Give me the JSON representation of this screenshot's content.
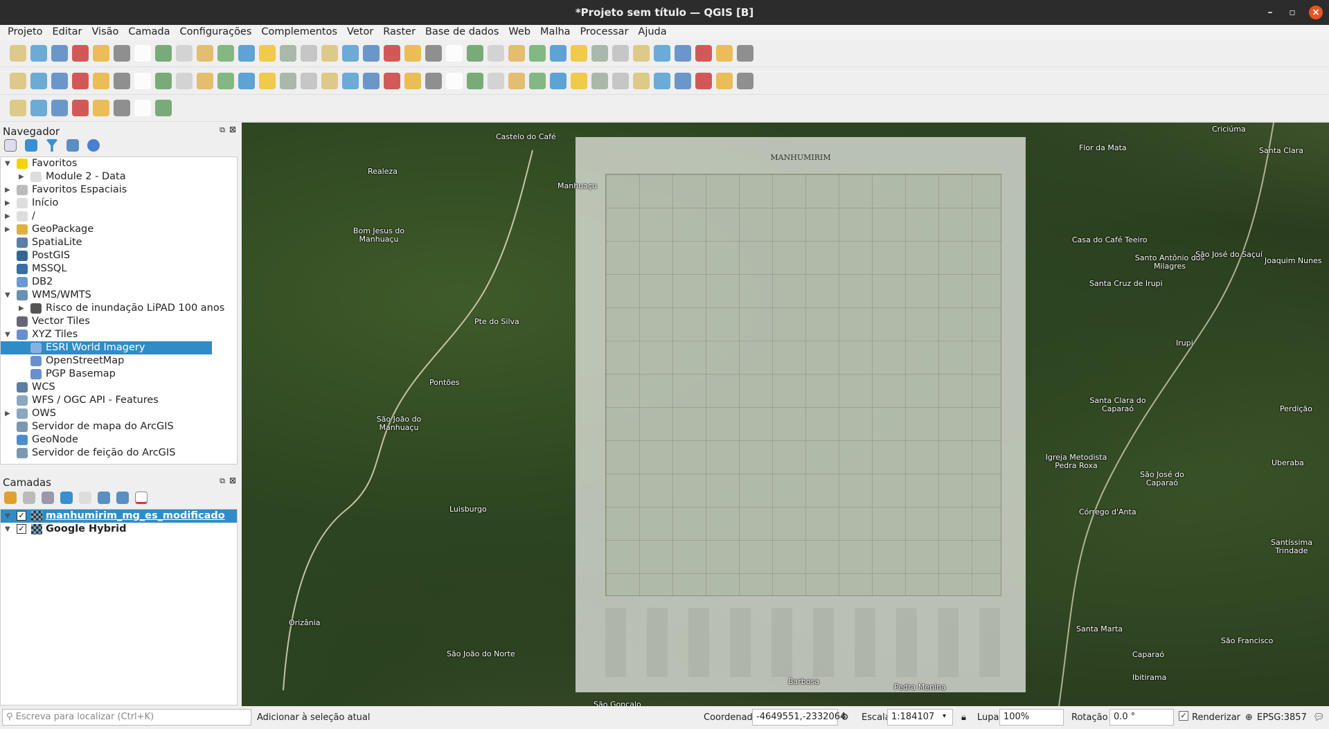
{
  "window": {
    "title": "*Projeto sem título — QGIS [B]"
  },
  "menu": [
    "Projeto",
    "Editar",
    "Visão",
    "Camada",
    "Configurações",
    "Complementos",
    "Vetor",
    "Raster",
    "Base de dados",
    "Web",
    "Malha",
    "Processar",
    "Ajuda"
  ],
  "browser": {
    "title": "Navegador",
    "items": [
      {
        "label": "Favoritos",
        "level": 0,
        "arrow": "down",
        "icon": "star-icon",
        "color": "#f5d300"
      },
      {
        "label": "Module 2 - Data",
        "level": 1,
        "arrow": "right",
        "icon": "folder-icon",
        "color": "#ddd"
      },
      {
        "label": "Favoritos Espaciais",
        "level": 0,
        "arrow": "right",
        "icon": "bookmark-icon",
        "color": "#bbb"
      },
      {
        "label": "Início",
        "level": 0,
        "arrow": "right",
        "icon": "home-icon",
        "color": "#ddd"
      },
      {
        "label": "/",
        "level": 0,
        "arrow": "right",
        "icon": "folder-icon",
        "color": "#ddd"
      },
      {
        "label": "GeoPackage",
        "level": 0,
        "arrow": "right",
        "icon": "geopackage-icon",
        "color": "#e0b040"
      },
      {
        "label": "SpatiaLite",
        "level": 0,
        "arrow": "",
        "icon": "feather-icon",
        "color": "#5a7fa8"
      },
      {
        "label": "PostGIS",
        "level": 0,
        "arrow": "",
        "icon": "elephant-icon",
        "color": "#336791"
      },
      {
        "label": "MSSQL",
        "level": 0,
        "arrow": "",
        "icon": "mssql-icon",
        "color": "#3a6ea5"
      },
      {
        "label": "DB2",
        "level": 0,
        "arrow": "",
        "icon": "db2-icon",
        "color": "#6a9ad0"
      },
      {
        "label": "WMS/WMTS",
        "level": 0,
        "arrow": "down",
        "icon": "globe-icon",
        "color": "#6a8fb0"
      },
      {
        "label": "Risco de inundação LiPAD 100 anos",
        "level": 1,
        "arrow": "right",
        "icon": "layer-icon",
        "color": "#555"
      },
      {
        "label": "Vector Tiles",
        "level": 0,
        "arrow": "",
        "icon": "grid-icon",
        "color": "#667"
      },
      {
        "label": "XYZ Tiles",
        "level": 0,
        "arrow": "down",
        "icon": "tiles-icon",
        "color": "#6a8fd0"
      },
      {
        "label": "ESRI World Imagery",
        "level": 1,
        "arrow": "",
        "icon": "tiles-icon",
        "color": "#8ab0e0",
        "selected": true
      },
      {
        "label": "OpenStreetMap",
        "level": 1,
        "arrow": "",
        "icon": "tiles-icon",
        "color": "#6a8fd0"
      },
      {
        "label": "PGP Basemap",
        "level": 1,
        "arrow": "",
        "icon": "tiles-icon",
        "color": "#6a8fd0"
      },
      {
        "label": "WCS",
        "level": 0,
        "arrow": "",
        "icon": "globe-icon",
        "color": "#5a7fa0"
      },
      {
        "label": "WFS / OGC API - Features",
        "level": 0,
        "arrow": "",
        "icon": "globe-icon",
        "color": "#8aa8c0"
      },
      {
        "label": "OWS",
        "level": 0,
        "arrow": "right",
        "icon": "globe-icon",
        "color": "#8aa8c0"
      },
      {
        "label": "Servidor de mapa do ArcGIS",
        "level": 0,
        "arrow": "",
        "icon": "globe-icon",
        "color": "#7a98b0"
      },
      {
        "label": "GeoNode",
        "level": 0,
        "arrow": "",
        "icon": "geonode-icon",
        "color": "#4a8fd0"
      },
      {
        "label": "Servidor de feição do ArcGIS",
        "level": 0,
        "arrow": "",
        "icon": "globe-icon",
        "color": "#7a98b0"
      }
    ]
  },
  "layers": {
    "title": "Camadas",
    "items": [
      {
        "label": "manhumirim_mg_es_modificado",
        "checked": true,
        "selected": true
      },
      {
        "label": "Google Hybrid",
        "checked": true,
        "selected": false
      }
    ]
  },
  "map": {
    "labels": [
      "Castelo do Café",
      "Realeza",
      "Manhuaçu",
      "Bom Jesus do Manhuaçu",
      "Pte do Silva",
      "Pontões",
      "São João do Manhuaçu",
      "Luisburgo",
      "Orizânia",
      "São João do Norte",
      "São Gonçalo",
      "Criciúma",
      "Flor da Mata",
      "Santa Clara",
      "Casa do Café Teeiro",
      "Santo Antônio dos Milagres",
      "São José do Saçuí",
      "Joaquim Nunes",
      "Santa Cruz de Irupi",
      "Irupi",
      "Santa Clara do Caparaó",
      "Perdição",
      "Igreja Metodista Pedra Roxa",
      "São José do Caparaó",
      "Uberaba",
      "Córrego d'Anta",
      "Santíssima Trindade",
      "Santa Marta",
      "São Francisco",
      "Caparaó",
      "Ibitirama",
      "Barbosa",
      "Pedra Menina"
    ],
    "overlay_title": "MANHUMIRIM"
  },
  "status": {
    "search_placeholder": "Escreva para localizar (Ctrl+K)",
    "message": "Adicionar à seleção atual",
    "coord_label": "Coordenada",
    "coord": "-4649551,-2332064",
    "scale_label": "Escala",
    "scale": "1:184107",
    "zoom_label": "Lupa",
    "zoom": "100%",
    "rotation_label": "Rotação",
    "rotation": "0.0 °",
    "render_label": "Renderizar",
    "render_checked": true,
    "crs": "EPSG:3857"
  }
}
